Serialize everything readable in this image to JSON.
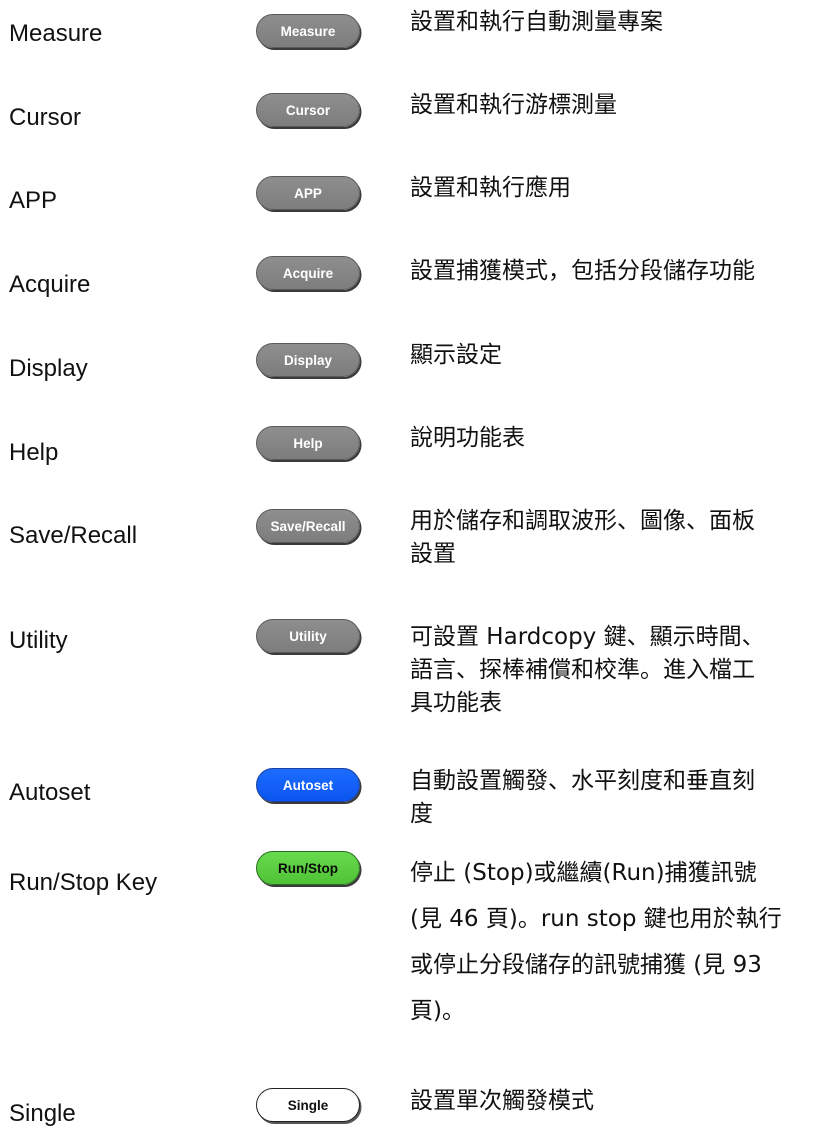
{
  "rows": [
    {
      "name": "Measure",
      "key": "Measure",
      "desc": [
        "設置和執行自動測量專案"
      ]
    },
    {
      "name": "Cursor",
      "key": "Cursor",
      "desc": [
        "設置和執行游標測量"
      ]
    },
    {
      "name": "APP",
      "key": "APP",
      "desc": [
        "設置和執行應用"
      ]
    },
    {
      "name": "Acquire",
      "key": "Acquire",
      "desc": [
        "設置捕獲模式，包括分段儲存功能"
      ]
    },
    {
      "name": "Display",
      "key": "Display",
      "desc": [
        "顯示設定"
      ]
    },
    {
      "name": "Help",
      "key": "Help",
      "desc": [
        "說明功能表"
      ]
    },
    {
      "name": "Save/Recall",
      "key": "Save/Recall",
      "desc": [
        "用於儲存和調取波形、圖像、面板",
        "設置"
      ]
    },
    {
      "name": "Utility",
      "key": "Utility",
      "desc": [
        "可設置 Hardcopy 鍵、顯示時間、",
        "語言、探棒補償和校準。進入檔工",
        "具功能表"
      ]
    },
    {
      "name": "Autoset",
      "key": "Autoset",
      "desc": [
        "自動設置觸發、水平刻度和垂直刻",
        "度"
      ]
    },
    {
      "name": "Run/Stop Key",
      "key": "Run/Stop",
      "desc": [
        "停止 (Stop)或繼續(Run)捕獲訊號",
        "(見 46 頁)。run stop 鍵也用於執行",
        "或停止分段儲存的訊號捕獲 (見 93",
        "頁)。"
      ]
    },
    {
      "name": "Single",
      "key": "Single",
      "desc": [
        "設置單次觸發模式"
      ]
    }
  ],
  "colors": {
    "key_gray": "#8a8a8a",
    "autoset_blue": "#1560f8",
    "runstop_green": "#5ccf43",
    "single_white": "#ffffff"
  }
}
